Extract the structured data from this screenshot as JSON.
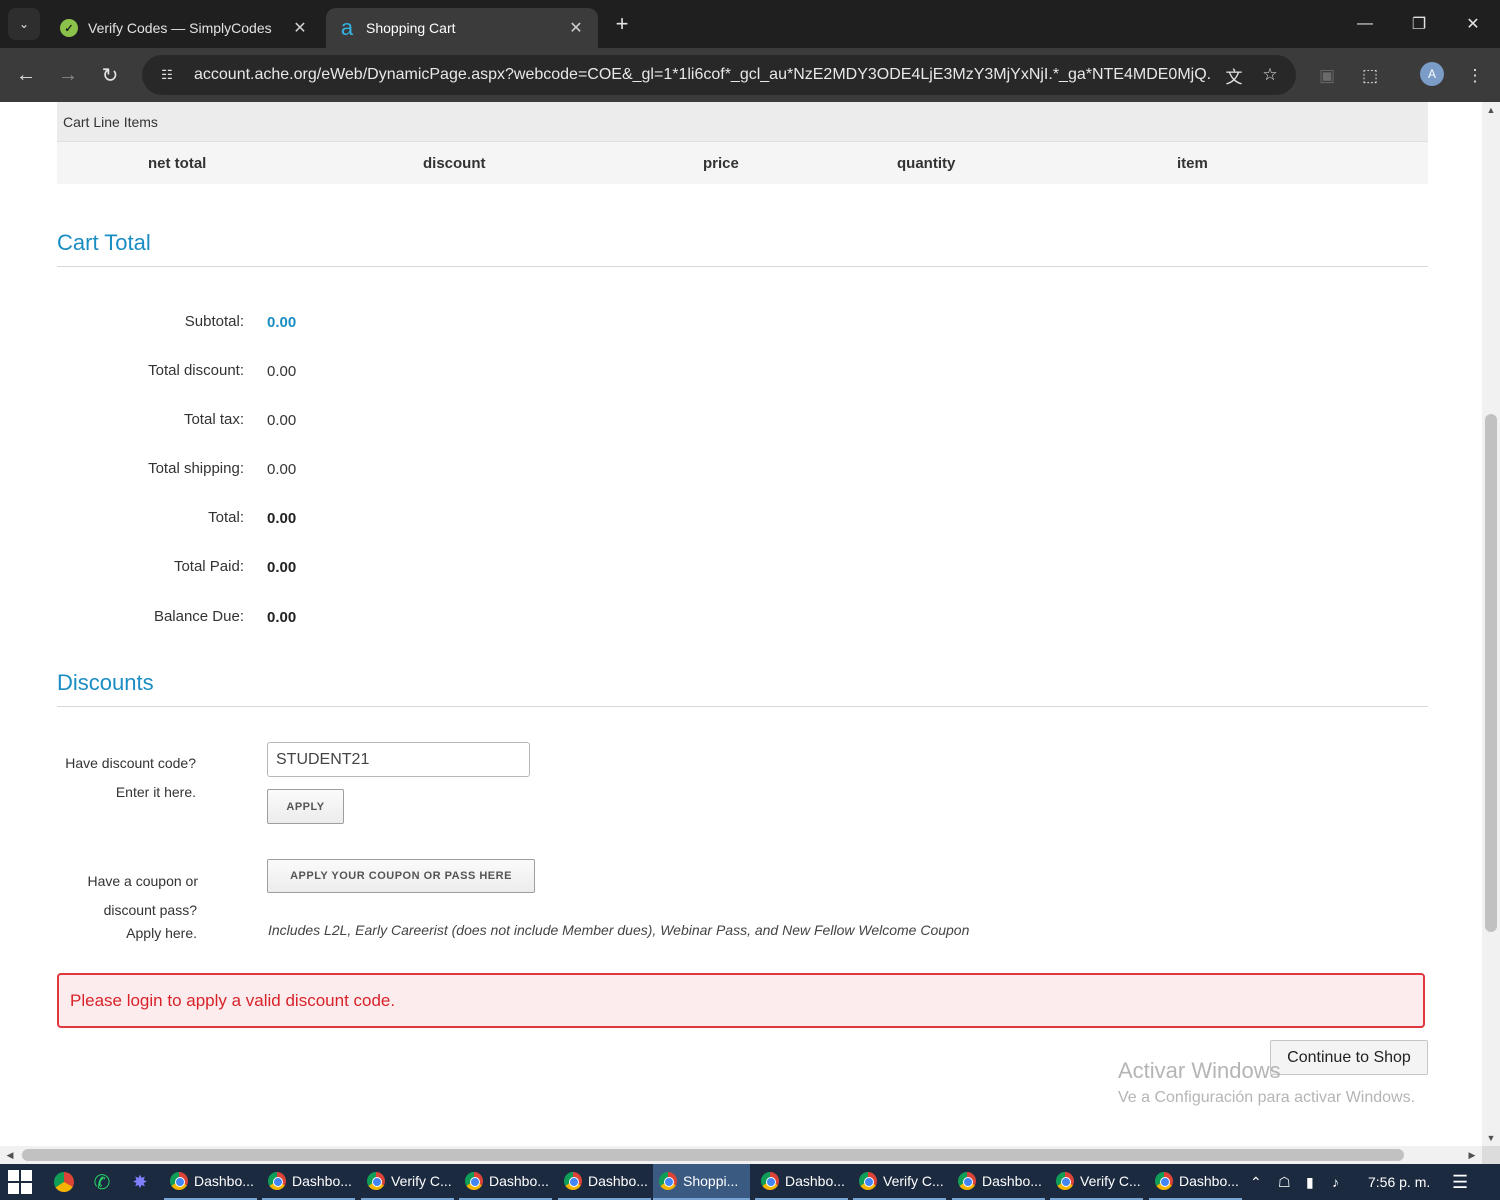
{
  "browser": {
    "tabs": [
      {
        "title": "Verify Codes — SimplyCodes",
        "favicon": "simplycodes-icon",
        "active": false
      },
      {
        "title": "Shopping Cart",
        "favicon": "ache-icon",
        "active": true
      }
    ],
    "url": "account.ache.org/eWeb/DynamicPage.aspx?webcode=COE&_gl=1*1li6cof*_gcl_au*NzE2MDY3ODE4LjE3MzY3MjYxNjI.*_ga*NTE4MDE0MjQ...",
    "profile_initial": "A"
  },
  "cart_line_items": {
    "header": "Cart Line Items",
    "columns": [
      "net total",
      "discount",
      "price",
      "quantity",
      "item"
    ]
  },
  "cart_total": {
    "title": "Cart Total",
    "rows": [
      {
        "label": "Subtotal:",
        "value": "0.00"
      },
      {
        "label": "Total discount:",
        "value": "0.00"
      },
      {
        "label": "Total tax:",
        "value": "0.00"
      },
      {
        "label": "Total shipping:",
        "value": "0.00"
      },
      {
        "label": "Total:",
        "value": "0.00"
      },
      {
        "label": "Total Paid:",
        "value": "0.00"
      },
      {
        "label": "Balance Due:",
        "value": "0.00"
      }
    ]
  },
  "discounts": {
    "title": "Discounts",
    "code_label_1": "Have discount code?",
    "code_label_2": "Enter it here.",
    "code_value": "STUDENT21",
    "apply_label": "APPLY",
    "coupon_label_1": "Have a coupon or",
    "coupon_label_2": "discount pass?",
    "coupon_label_3": "Apply here.",
    "coupon_button_label": "APPLY YOUR COUPON OR PASS HERE",
    "coupon_note": "Includes L2L, Early Careerist (does not include Member dues), Webinar Pass, and New Fellow Welcome Coupon"
  },
  "alert": {
    "message": "Please login to apply a valid discount code."
  },
  "continue_label": "Continue to Shop",
  "watermark": {
    "line1": "Activar Windows",
    "line2": "Ve a Configuración para activar Windows."
  },
  "taskbar": {
    "items": [
      "Dashbo...",
      "Dashbo...",
      "Verify C...",
      "Dashbo...",
      "Dashbo...",
      "Shoppi...",
      "Dashbo...",
      "Verify C...",
      "Dashbo...",
      "Verify C...",
      "Dashbo..."
    ],
    "active_index": 5,
    "clock": "7:56 p. m."
  },
  "colors": {
    "accent": "#1a8dc2",
    "alert_border": "#e0373f",
    "alert_text": "#d8232a"
  }
}
